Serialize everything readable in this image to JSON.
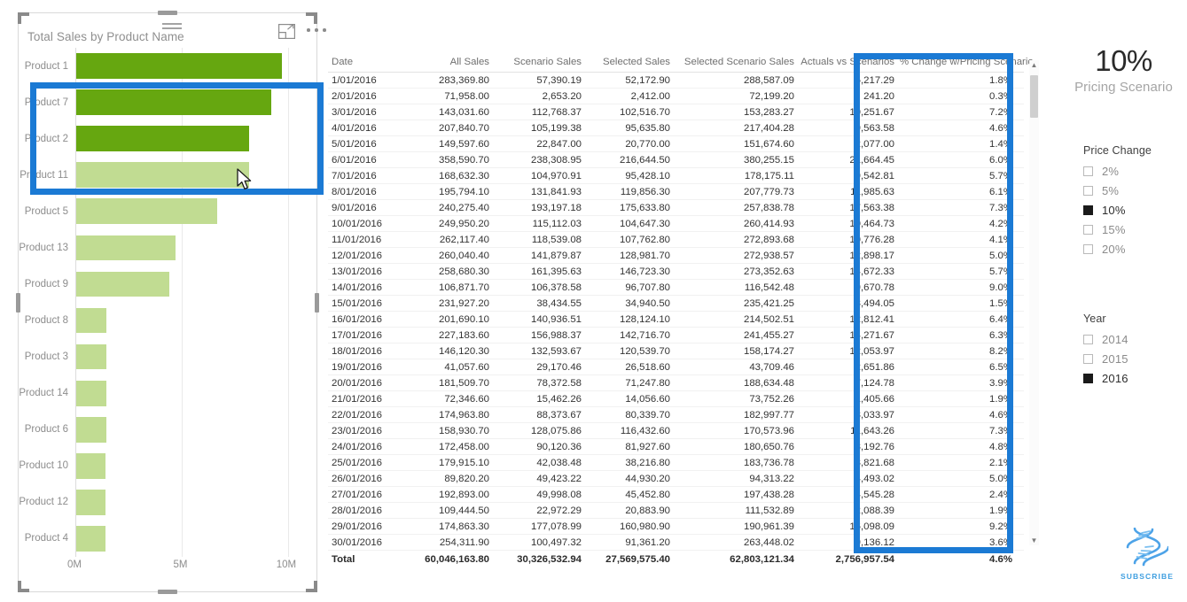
{
  "chart_visual": {
    "title": "Total Sales by Product Name",
    "icons": {
      "filter": "filter-icon",
      "focus": "focus-mode-icon",
      "more": "more-options-icon"
    },
    "highlight_color": "#1b7ad4",
    "bar_color_highlighted": "#66a710",
    "bar_color_normal": "#c1dc92"
  },
  "chart_data": {
    "type": "bar",
    "title": "Total Sales by Product Name",
    "orientation": "horizontal",
    "xlabel": "",
    "ylabel": "",
    "xlim": [
      0,
      10800000
    ],
    "grid": true,
    "tick_labels": [
      "0M",
      "5M",
      "10M"
    ],
    "tick_values": [
      0,
      5000000,
      10000000
    ],
    "categories": [
      "Product 1",
      "Product 7",
      "Product 2",
      "Product 11",
      "Product 5",
      "Product 13",
      "Product 9",
      "Product 8",
      "Product 3",
      "Product 14",
      "Product 6",
      "Product 10",
      "Product 12",
      "Product 4"
    ],
    "values": [
      9700000,
      9200000,
      8150000,
      8150000,
      6650000,
      4700000,
      4400000,
      1430000,
      1430000,
      1430000,
      1430000,
      1380000,
      1400000,
      1380000
    ],
    "highlighted": [
      true,
      true,
      true,
      false,
      false,
      false,
      false,
      false,
      false,
      false,
      false,
      false,
      false,
      false
    ]
  },
  "table": {
    "columns": [
      "Date",
      "All Sales",
      "Scenario Sales",
      "Selected Sales",
      "Selected Scenario Sales",
      "Actuals vs Scenarios",
      "% Change w/Pricing Scenario"
    ],
    "rows": [
      [
        "1/01/2016",
        "283,369.80",
        "57,390.19",
        "52,172.90",
        "288,587.09",
        "5,217.29",
        "1.8%"
      ],
      [
        "2/01/2016",
        "71,958.00",
        "2,653.20",
        "2,412.00",
        "72,199.20",
        "241.20",
        "0.3%"
      ],
      [
        "3/01/2016",
        "143,031.60",
        "112,768.37",
        "102,516.70",
        "153,283.27",
        "10,251.67",
        "7.2%"
      ],
      [
        "4/01/2016",
        "207,840.70",
        "105,199.38",
        "95,635.80",
        "217,404.28",
        "9,563.58",
        "4.6%"
      ],
      [
        "5/01/2016",
        "149,597.60",
        "22,847.00",
        "20,770.00",
        "151,674.60",
        "2,077.00",
        "1.4%"
      ],
      [
        "6/01/2016",
        "358,590.70",
        "238,308.95",
        "216,644.50",
        "380,255.15",
        "21,664.45",
        "6.0%"
      ],
      [
        "7/01/2016",
        "168,632.30",
        "104,970.91",
        "95,428.10",
        "178,175.11",
        "9,542.81",
        "5.7%"
      ],
      [
        "8/01/2016",
        "195,794.10",
        "131,841.93",
        "119,856.30",
        "207,779.73",
        "11,985.63",
        "6.1%"
      ],
      [
        "9/01/2016",
        "240,275.40",
        "193,197.18",
        "175,633.80",
        "257,838.78",
        "17,563.38",
        "7.3%"
      ],
      [
        "10/01/2016",
        "249,950.20",
        "115,112.03",
        "104,647.30",
        "260,414.93",
        "10,464.73",
        "4.2%"
      ],
      [
        "11/01/2016",
        "262,117.40",
        "118,539.08",
        "107,762.80",
        "272,893.68",
        "10,776.28",
        "4.1%"
      ],
      [
        "12/01/2016",
        "260,040.40",
        "141,879.87",
        "128,981.70",
        "272,938.57",
        "12,898.17",
        "5.0%"
      ],
      [
        "13/01/2016",
        "258,680.30",
        "161,395.63",
        "146,723.30",
        "273,352.63",
        "14,672.33",
        "5.7%"
      ],
      [
        "14/01/2016",
        "106,871.70",
        "106,378.58",
        "96,707.80",
        "116,542.48",
        "9,670.78",
        "9.0%"
      ],
      [
        "15/01/2016",
        "231,927.20",
        "38,434.55",
        "34,940.50",
        "235,421.25",
        "3,494.05",
        "1.5%"
      ],
      [
        "16/01/2016",
        "201,690.10",
        "140,936.51",
        "128,124.10",
        "214,502.51",
        "12,812.41",
        "6.4%"
      ],
      [
        "17/01/2016",
        "227,183.60",
        "156,988.37",
        "142,716.70",
        "241,455.27",
        "14,271.67",
        "6.3%"
      ],
      [
        "18/01/2016",
        "146,120.30",
        "132,593.67",
        "120,539.70",
        "158,174.27",
        "12,053.97",
        "8.2%"
      ],
      [
        "19/01/2016",
        "41,057.60",
        "29,170.46",
        "26,518.60",
        "43,709.46",
        "2,651.86",
        "6.5%"
      ],
      [
        "20/01/2016",
        "181,509.70",
        "78,372.58",
        "71,247.80",
        "188,634.48",
        "7,124.78",
        "3.9%"
      ],
      [
        "21/01/2016",
        "72,346.60",
        "15,462.26",
        "14,056.60",
        "73,752.26",
        "1,405.66",
        "1.9%"
      ],
      [
        "22/01/2016",
        "174,963.80",
        "88,373.67",
        "80,339.70",
        "182,997.77",
        "8,033.97",
        "4.6%"
      ],
      [
        "23/01/2016",
        "158,930.70",
        "128,075.86",
        "116,432.60",
        "170,573.96",
        "11,643.26",
        "7.3%"
      ],
      [
        "24/01/2016",
        "172,458.00",
        "90,120.36",
        "81,927.60",
        "180,650.76",
        "8,192.76",
        "4.8%"
      ],
      [
        "25/01/2016",
        "179,915.10",
        "42,038.48",
        "38,216.80",
        "183,736.78",
        "3,821.68",
        "2.1%"
      ],
      [
        "26/01/2016",
        "89,820.20",
        "49,423.22",
        "44,930.20",
        "94,313.22",
        "4,493.02",
        "5.0%"
      ],
      [
        "27/01/2016",
        "192,893.00",
        "49,998.08",
        "45,452.80",
        "197,438.28",
        "4,545.28",
        "2.4%"
      ],
      [
        "28/01/2016",
        "109,444.50",
        "22,972.29",
        "20,883.90",
        "111,532.89",
        "2,088.39",
        "1.9%"
      ],
      [
        "29/01/2016",
        "174,863.30",
        "177,078.99",
        "160,980.90",
        "190,961.39",
        "16,098.09",
        "9.2%"
      ],
      [
        "30/01/2016",
        "254,311.90",
        "100,497.32",
        "91,361.20",
        "263,448.02",
        "9,136.12",
        "3.6%"
      ]
    ],
    "total_row": [
      "Total",
      "60,046,163.80",
      "30,326,532.94",
      "27,569,575.40",
      "62,803,121.34",
      "2,756,957.54",
      "4.6%"
    ]
  },
  "kpi": {
    "value": "10%",
    "label": "Pricing Scenario"
  },
  "price_change_slicer": {
    "title": "Price Change",
    "items": [
      {
        "label": "2%",
        "checked": false
      },
      {
        "label": "5%",
        "checked": false
      },
      {
        "label": "10%",
        "checked": true
      },
      {
        "label": "15%",
        "checked": false
      },
      {
        "label": "20%",
        "checked": false
      }
    ]
  },
  "year_slicer": {
    "title": "Year",
    "items": [
      {
        "label": "2014",
        "checked": false
      },
      {
        "label": "2015",
        "checked": false
      },
      {
        "label": "2016",
        "checked": true
      }
    ]
  },
  "subscribe": {
    "label": "SUBSCRIBE",
    "icon": "dna-helix-icon",
    "color": "#3f9fe0"
  }
}
